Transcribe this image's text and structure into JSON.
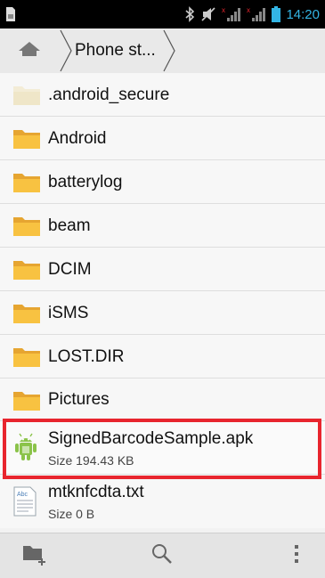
{
  "status_bar": {
    "time": "14:20",
    "accent_color": "#33b5e5",
    "icons": [
      "sim-card-icon",
      "bluetooth-icon",
      "mute-icon",
      "signal-icon",
      "signal-icon",
      "battery-icon"
    ]
  },
  "path_bar": {
    "home_icon": "home-icon",
    "breadcrumb": "Phone st..."
  },
  "folders": [
    {
      "name": ".android_secure",
      "hidden": true
    },
    {
      "name": "Android"
    },
    {
      "name": "batterylog"
    },
    {
      "name": "beam"
    },
    {
      "name": "DCIM"
    },
    {
      "name": "iSMS"
    },
    {
      "name": "LOST.DIR"
    },
    {
      "name": "Pictures"
    }
  ],
  "files": [
    {
      "name": "SignedBarcodeSample.apk",
      "size": "Size 194.43 KB",
      "icon": "android-apk-icon",
      "highlighted": true
    },
    {
      "name": "mtknfcdta.txt",
      "size": "Size 0 B",
      "icon": "text-file-icon"
    }
  ],
  "bottom_bar": {
    "icons": [
      "new-folder-icon",
      "search-icon",
      "overflow-menu-icon"
    ]
  },
  "highlight_color": "#e8252e"
}
